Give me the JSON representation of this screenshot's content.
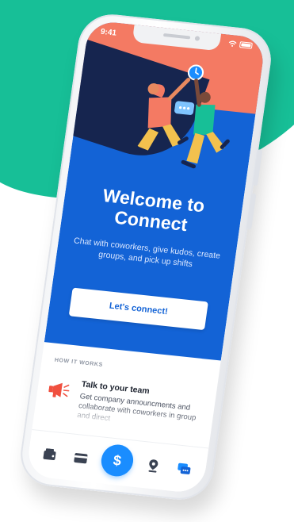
{
  "status_bar": {
    "time": "9:41"
  },
  "hero": {
    "title_line1": "Welcome to",
    "title_line2": "Connect",
    "subtitle": "Chat with coworkers, give kudos, create groups, and pick up shifts",
    "cta_label": "Let's connect!"
  },
  "how_it_works": {
    "heading": "HOW IT WORKS",
    "feature": {
      "title": "Talk to your team",
      "description": "Get company announcments and collaborate with coworkers in group and direct"
    }
  },
  "tabbar": {
    "pay_symbol": "$",
    "items": [
      "wallet-icon",
      "card-icon",
      "pay-button",
      "location-icon",
      "chat-icon"
    ]
  },
  "colors": {
    "teal": "#17bf97",
    "hero_blue": "#1363d6",
    "coral": "#f47a63",
    "navy": "#16254f",
    "accent_blue": "#1a8dff",
    "megaphone_red": "#f0503f"
  }
}
